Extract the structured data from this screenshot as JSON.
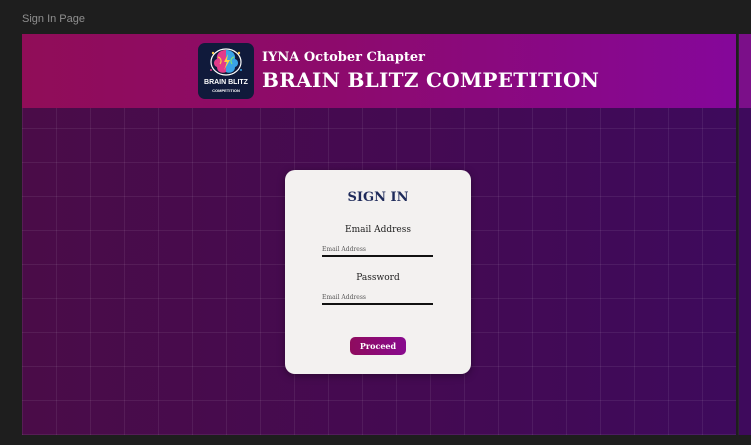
{
  "frame_label": "Sign In Page",
  "header": {
    "logo": {
      "icon": "brain-icon",
      "line1": "BRAIN BLITZ",
      "line2": "COMPETITION"
    },
    "subtitle": "IYNA October Chapter",
    "title": "BRAIN BLITZ COMPETITION"
  },
  "signin": {
    "title": "SIGN IN",
    "email_label": "Email Address",
    "email_placeholder": "Email Address",
    "password_label": "Password",
    "password_placeholder": "Email Address",
    "submit_label": "Proceed"
  },
  "colors": {
    "header_start": "#900d58",
    "header_end": "#85079a",
    "background": "#440a52",
    "card": "#f3f1f0",
    "title_text": "#1e2a5a"
  }
}
